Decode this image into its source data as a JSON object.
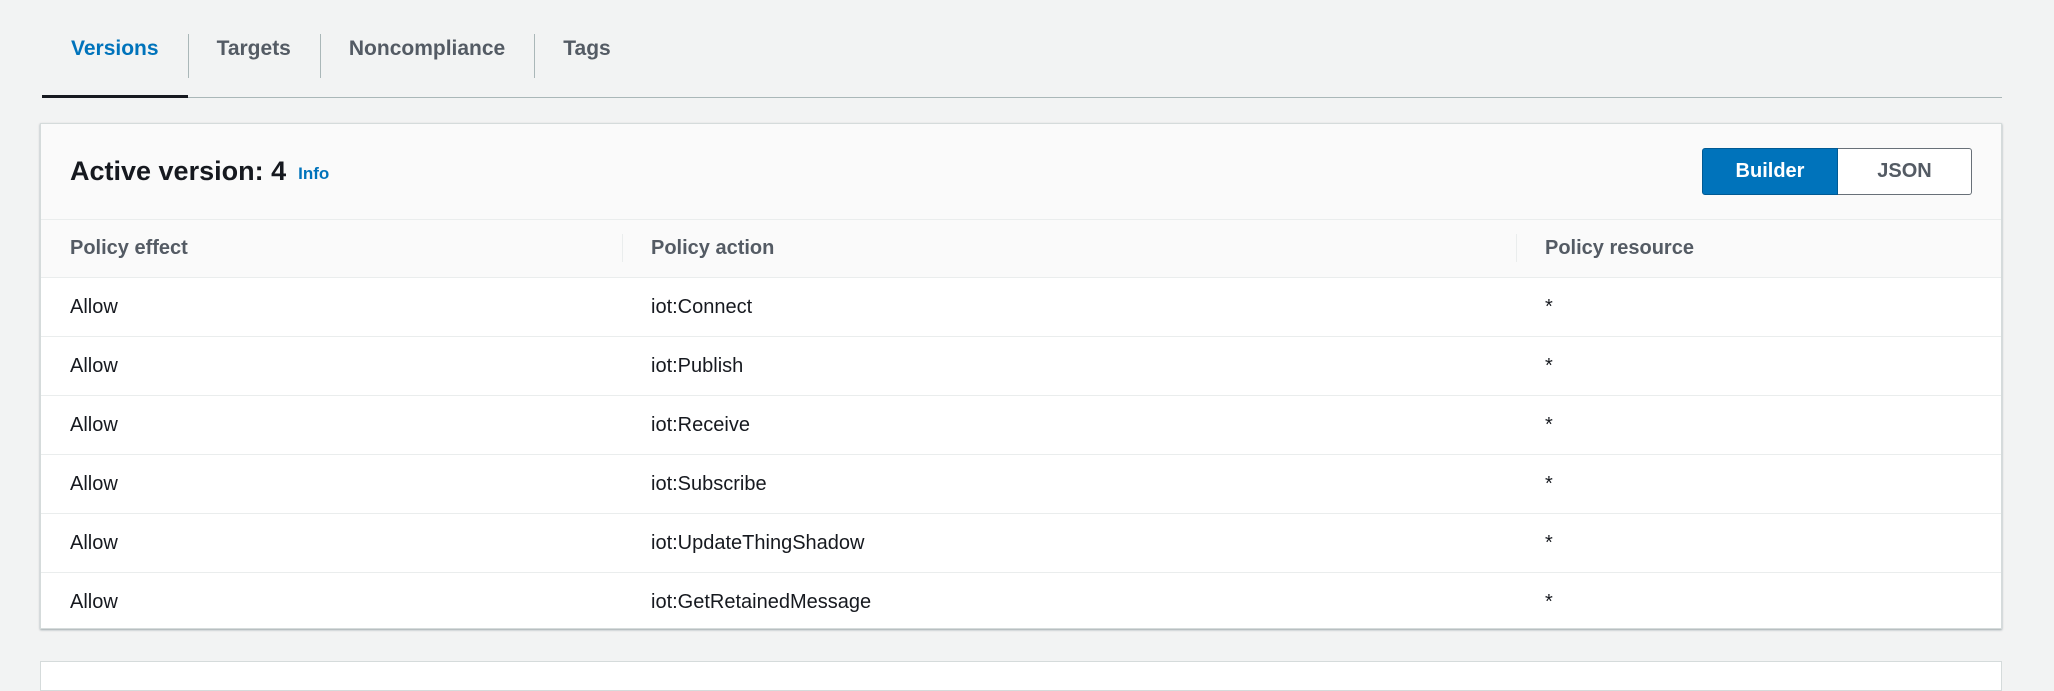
{
  "tabs": [
    {
      "label": "Versions",
      "active": true
    },
    {
      "label": "Targets",
      "active": false
    },
    {
      "label": "Noncompliance",
      "active": false
    },
    {
      "label": "Tags",
      "active": false
    }
  ],
  "panel": {
    "title": "Active version: 4",
    "info_label": "Info",
    "view_toggle": {
      "builder_label": "Builder",
      "json_label": "JSON",
      "selected": "Builder"
    }
  },
  "table": {
    "columns": [
      "Policy effect",
      "Policy action",
      "Policy resource"
    ],
    "rows": [
      {
        "effect": "Allow",
        "action": "iot:Connect",
        "resource": "*"
      },
      {
        "effect": "Allow",
        "action": "iot:Publish",
        "resource": "*"
      },
      {
        "effect": "Allow",
        "action": "iot:Receive",
        "resource": "*"
      },
      {
        "effect": "Allow",
        "action": "iot:Subscribe",
        "resource": "*"
      },
      {
        "effect": "Allow",
        "action": "iot:UpdateThingShadow",
        "resource": "*"
      },
      {
        "effect": "Allow",
        "action": "iot:GetRetainedMessage",
        "resource": "*"
      }
    ]
  },
  "colors": {
    "accent": "#0073bb",
    "background": "#f2f3f3",
    "text": "#16191f",
    "muted": "#545b64"
  }
}
